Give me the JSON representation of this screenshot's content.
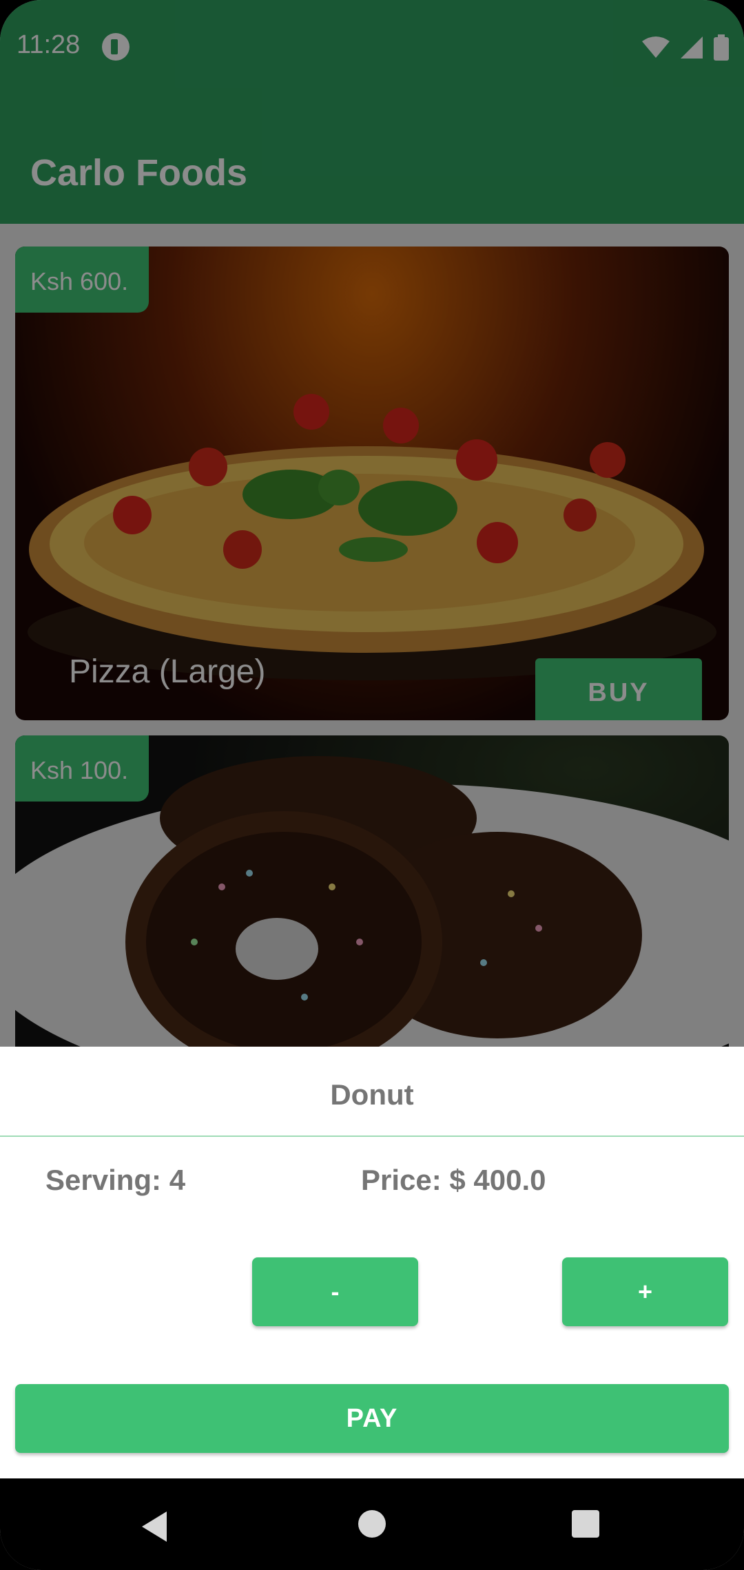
{
  "status_bar": {
    "time": "11:28",
    "icons": [
      "app-notification-icon",
      "wifi-icon",
      "signal-icon",
      "battery-icon"
    ]
  },
  "app_bar": {
    "title": "Carlo Foods"
  },
  "food_list": [
    {
      "price": "Ksh 600.",
      "name": "Pizza (Large)",
      "buy_label": "BUY"
    },
    {
      "price": "Ksh 100."
    }
  ],
  "sheet": {
    "title": "Donut",
    "serving": "Serving: 4",
    "price": "Price: $ 400.0",
    "minus_label": "-",
    "plus_label": "+",
    "pay_label": "PAY"
  },
  "colors": {
    "primary": "#2e9e5e",
    "accent": "#3ec174",
    "text_gray": "#757575"
  },
  "nav_bar": {
    "icons": [
      "back-icon",
      "home-icon",
      "recents-icon"
    ]
  }
}
